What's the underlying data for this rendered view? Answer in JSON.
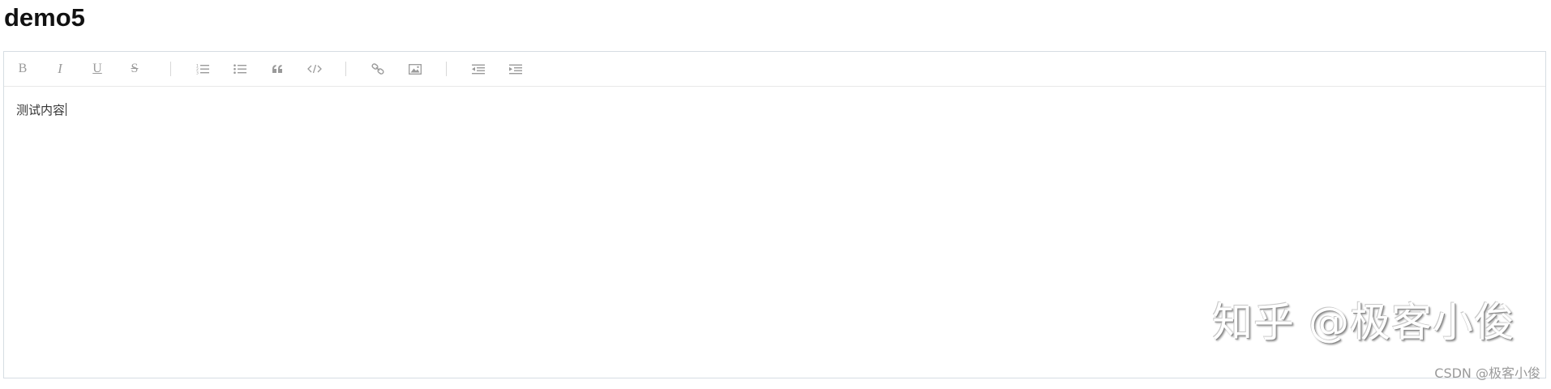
{
  "page": {
    "title": "demo5"
  },
  "toolbar": {
    "buttons": [
      {
        "id": "bold",
        "label": "B",
        "icon": "bold-icon"
      },
      {
        "id": "italic",
        "label": "I",
        "icon": "italic-icon"
      },
      {
        "id": "underline",
        "label": "U",
        "icon": "underline-icon"
      },
      {
        "id": "strike",
        "label": "S",
        "icon": "strikethrough-icon"
      },
      {
        "id": "ordered-list",
        "icon": "ordered-list-icon"
      },
      {
        "id": "bullet-list",
        "icon": "bullet-list-icon"
      },
      {
        "id": "blockquote",
        "icon": "quote-icon"
      },
      {
        "id": "code-block",
        "icon": "code-icon"
      },
      {
        "id": "link",
        "icon": "link-icon"
      },
      {
        "id": "image",
        "icon": "image-icon"
      },
      {
        "id": "indent-decrease",
        "icon": "outdent-icon"
      },
      {
        "id": "indent-increase",
        "icon": "indent-icon"
      }
    ],
    "icon_color": "#9a9a9a"
  },
  "editor": {
    "content": "测试内容"
  },
  "watermark": {
    "main": "知乎 @极客小俊",
    "csdn": "CSDN @极客小俊"
  }
}
